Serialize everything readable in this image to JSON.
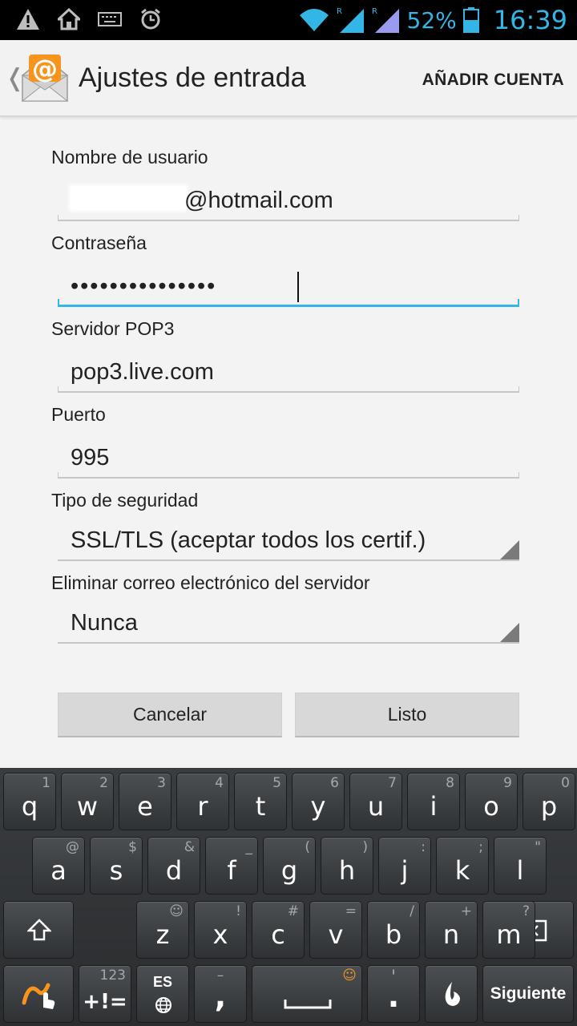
{
  "status_bar": {
    "battery_percent": "52%",
    "time": "16:39",
    "roaming_marker": "R",
    "icons": [
      "warning-icon",
      "home-icon",
      "keyboard-icon",
      "alarm-icon",
      "wifi-icon",
      "signal-icon",
      "battery-icon"
    ]
  },
  "action_bar": {
    "up_symbol": "❬",
    "title": "Ajustes de entrada",
    "action_label": "AÑADIR CUENTA",
    "logo": "email-at-icon"
  },
  "form": {
    "username": {
      "label": "Nombre de usuario",
      "value": "@hotmail.com"
    },
    "password": {
      "label": "Contraseña",
      "value": "•••••••••••••••"
    },
    "server": {
      "label": "Servidor POP3",
      "value": "pop3.live.com"
    },
    "port": {
      "label": "Puerto",
      "value": "995"
    },
    "security": {
      "label": "Tipo de seguridad",
      "value": "SSL/TLS (aceptar todos los certif.)"
    },
    "delete_mail": {
      "label": "Eliminar correo electrónico del servidor",
      "value": "Nunca"
    }
  },
  "buttons": {
    "cancel": "Cancelar",
    "done": "Listo"
  },
  "colors": {
    "accent": "#33b5e5",
    "background": "#f3f3f3"
  },
  "keyboard": {
    "row1": [
      {
        "main": "q",
        "hint": "1"
      },
      {
        "main": "w",
        "hint": "2"
      },
      {
        "main": "e",
        "hint": "3"
      },
      {
        "main": "r",
        "hint": "4"
      },
      {
        "main": "t",
        "hint": "5"
      },
      {
        "main": "y",
        "hint": "6"
      },
      {
        "main": "u",
        "hint": "7"
      },
      {
        "main": "i",
        "hint": "8"
      },
      {
        "main": "o",
        "hint": "9"
      },
      {
        "main": "p",
        "hint": "0"
      }
    ],
    "row2": [
      {
        "main": "a",
        "hint": "@"
      },
      {
        "main": "s",
        "hint": "$"
      },
      {
        "main": "d",
        "hint": "&"
      },
      {
        "main": "f",
        "hint": "_"
      },
      {
        "main": "g",
        "hint": "("
      },
      {
        "main": "h",
        "hint": ")"
      },
      {
        "main": "j",
        "hint": ":"
      },
      {
        "main": "k",
        "hint": ";"
      },
      {
        "main": "l",
        "hint": "\""
      }
    ],
    "row3": [
      {
        "main": "z",
        "hint": "☺"
      },
      {
        "main": "x",
        "hint": "!"
      },
      {
        "main": "c",
        "hint": "#"
      },
      {
        "main": "v",
        "hint": "="
      },
      {
        "main": "b",
        "hint": "/"
      },
      {
        "main": "n",
        "hint": "+"
      },
      {
        "main": "m",
        "hint": "?"
      }
    ],
    "numeric_hint": "123",
    "numeric_label": "+!=",
    "language": "ES",
    "comma": ",",
    "comma_hint": "–",
    "period": ".",
    "period_hint": "'",
    "space_hint": "☺",
    "action_label": "Siguiente"
  }
}
